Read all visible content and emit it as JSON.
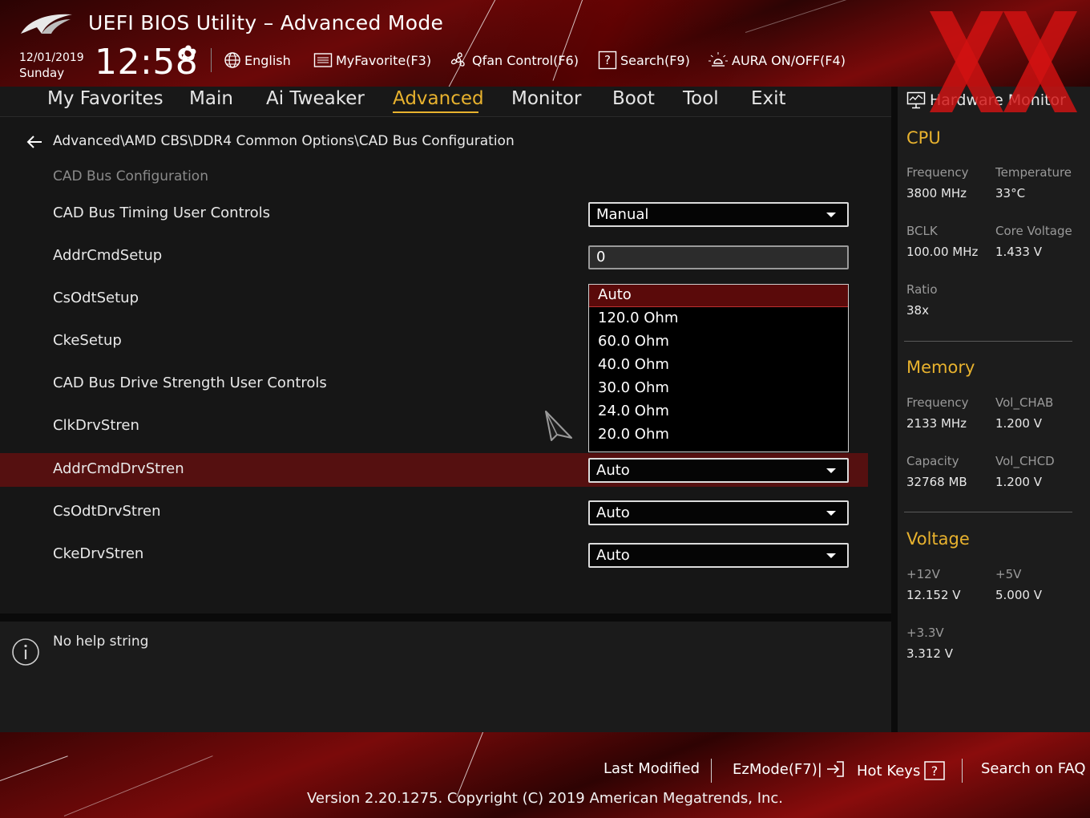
{
  "header": {
    "title": "UEFI BIOS Utility – Advanced Mode",
    "date": "12/01/2019",
    "day": "Sunday",
    "time": "12:58",
    "buttons": {
      "language": "English",
      "myfavorite": "MyFavorite(F3)",
      "qfan": "Qfan Control(F6)",
      "search": "Search(F9)",
      "aura": "AURA ON/OFF(F4)"
    }
  },
  "tabs": [
    {
      "label": "My Favorites"
    },
    {
      "label": "Main"
    },
    {
      "label": "Ai Tweaker"
    },
    {
      "label": "Advanced"
    },
    {
      "label": "Monitor"
    },
    {
      "label": "Boot"
    },
    {
      "label": "Tool"
    },
    {
      "label": "Exit"
    }
  ],
  "active_tab": "Advanced",
  "main": {
    "breadcrumb": "Advanced\\AMD CBS\\DDR4 Common Options\\CAD Bus Configuration",
    "section_title": "CAD Bus Configuration",
    "rows": [
      {
        "label": "CAD Bus Timing User Controls",
        "value": "Manual"
      },
      {
        "label": "AddrCmdSetup",
        "value": "0"
      },
      {
        "label": "CsOdtSetup"
      },
      {
        "label": "CkeSetup"
      },
      {
        "label": "CAD Bus Drive Strength User Controls"
      },
      {
        "label": "ClkDrvStren"
      },
      {
        "label": "AddrCmdDrvStren",
        "value": "Auto"
      },
      {
        "label": "CsOdtDrvStren",
        "value": "Auto"
      },
      {
        "label": "CkeDrvStren",
        "value": "Auto"
      }
    ],
    "dropdown_options": [
      "Auto",
      "120.0 Ohm",
      "60.0 Ohm",
      "40.0 Ohm",
      "30.0 Ohm",
      "24.0 Ohm",
      "20.0 Ohm"
    ],
    "dropdown_selected": "Auto"
  },
  "help": {
    "text": "No help string"
  },
  "hardware_monitor": {
    "title": "Hardware Monitor",
    "cpu": {
      "heading": "CPU",
      "frequency_label": "Frequency",
      "frequency": "3800 MHz",
      "temperature_label": "Temperature",
      "temperature": "33°C",
      "bclk_label": "BCLK",
      "bclk": "100.00 MHz",
      "core_voltage_label": "Core Voltage",
      "core_voltage": "1.433 V",
      "ratio_label": "Ratio",
      "ratio": "38x"
    },
    "memory": {
      "heading": "Memory",
      "frequency_label": "Frequency",
      "frequency": "2133 MHz",
      "vol_chab_label": "Vol_CHAB",
      "vol_chab": "1.200 V",
      "capacity_label": "Capacity",
      "capacity": "32768 MB",
      "vol_chcd_label": "Vol_CHCD",
      "vol_chcd": "1.200 V"
    },
    "voltage": {
      "heading": "Voltage",
      "v12_label": "+12V",
      "v12": "12.152 V",
      "v5_label": "+5V",
      "v5": "5.000 V",
      "v33_label": "+3.3V",
      "v33": "3.312 V"
    }
  },
  "footer": {
    "last_modified": "Last Modified",
    "ezmode": "EzMode(F7)|",
    "hotkeys": "Hot Keys",
    "faq": "Search on FAQ",
    "version": "Version 2.20.1275. Copyright (C) 2019 American Megatrends, Inc."
  },
  "colors": {
    "accent": "#e8b22e",
    "highlight_row": "#551010",
    "brand_red": "#7a0a0a"
  },
  "icons": [
    "rog-logo",
    "gear-icon",
    "globe-icon",
    "favorite-list-icon",
    "fan-icon",
    "search-help-icon",
    "aura-light-icon",
    "back-arrow-icon",
    "info-icon",
    "monitor-icon",
    "exit-arrow-icon",
    "question-icon",
    "xx-watermark"
  ]
}
